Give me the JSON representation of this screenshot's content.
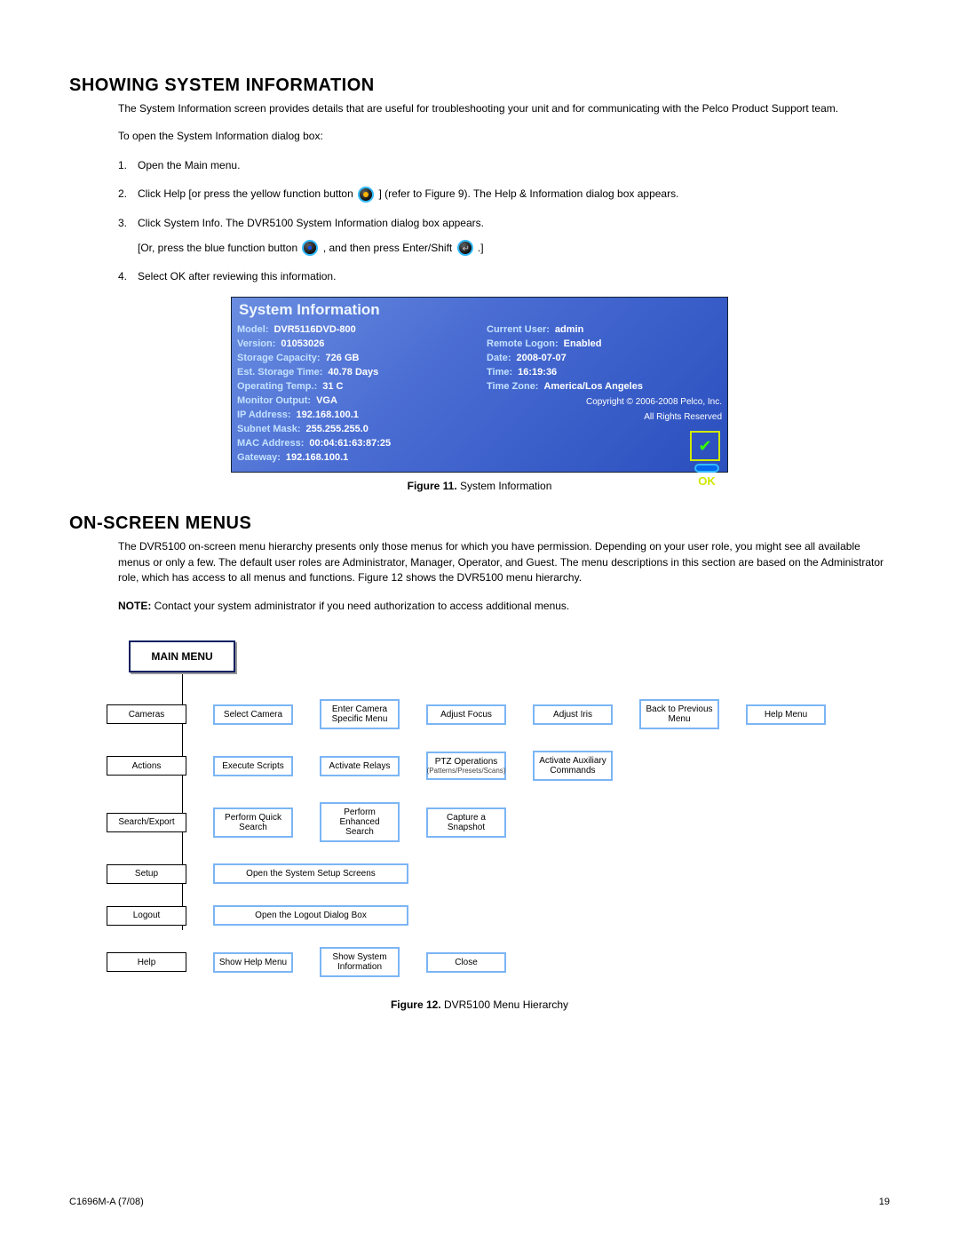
{
  "section1": {
    "heading": "SHOWING SYSTEM INFORMATION",
    "intro": "The System Information screen provides details that are useful for troubleshooting your unit and for communicating with the Pelco Product Support team.",
    "open_line": "To open the System Information dialog box:",
    "steps": {
      "s1": "Open the Main menu.",
      "s2a": "Click Help [or press the yellow function button",
      "s2b": "] (refer to Figure 9). The Help & Information dialog box appears.",
      "s3": "Click System Info. The DVR5100 System Information dialog box appears.",
      "s3sub_a": "[Or, press the blue function button",
      "s3sub_b": ", and then press Enter/Shift",
      "s3sub_c": ".]",
      "s4": "Select OK after reviewing this information."
    }
  },
  "sysinfo": {
    "title": "System Information",
    "left": {
      "model_l": "Model:",
      "model_v": "DVR5116DVD-800",
      "version_l": "Version:",
      "version_v": "01053026",
      "cap_l": "Storage Capacity:",
      "cap_v": "726  GB",
      "est_l": "Est. Storage Time:",
      "est_v": "40.78   Days",
      "temp_l": "Operating Temp.:",
      "temp_v": "31  C",
      "mon_l": "Monitor Output:",
      "mon_v": "VGA",
      "ip_l": "IP Address:",
      "ip_v": "192.168.100.1",
      "sub_l": "Subnet Mask:",
      "sub_v": "255.255.255.0",
      "mac_l": "MAC Address:",
      "mac_v": "00:04:61:63:87:25",
      "gw_l": "Gateway:",
      "gw_v": "192.168.100.1"
    },
    "right": {
      "cu_l": "Current User:",
      "cu_v": "admin",
      "rl_l": "Remote Logon:",
      "rl_v": "Enabled",
      "date_l": "Date:",
      "date_v": "2008-07-07",
      "time_l": "Time:",
      "time_v": "16:19:36",
      "tz_l": "Time Zone:",
      "tz_v": "America/Los Angeles",
      "copy1": "Copyright © 2006-2008 Pelco, Inc.",
      "copy2": "All Rights Reserved"
    },
    "ok": "OK"
  },
  "fig11": {
    "bold": "Figure 11.",
    "text": "  System Information"
  },
  "section2": {
    "heading": "ON-SCREEN MENUS",
    "para": "The DVR5100 on-screen menu hierarchy presents only those menus for which you have permission. Depending on your user role, you might see all available menus or only a few. The default user roles are Administrator, Manager, Operator, and Guest. The menu descriptions in this section are based on the Administrator role, which has access to all menus and functions. Figure 12 shows the DVR5100 menu hierarchy.",
    "note_bold": "NOTE:",
    "note_text": "  Contact your system administrator if you need authorization to access additional menus."
  },
  "diagram": {
    "main": "MAIN MENU",
    "r1": {
      "a": "Cameras",
      "b": "Select Camera",
      "c": "Enter Camera Specific Menu",
      "d": "Adjust Focus",
      "e": "Adjust Iris",
      "f": "Back to Previous Menu",
      "g": "Help Menu"
    },
    "r2": {
      "a": "Actions",
      "b": "Execute Scripts",
      "c": "Activate Relays",
      "d": "PTZ Operations",
      "dsub": "(Patterns/Presets/Scans)",
      "e": "Activate Auxiliary Commands"
    },
    "r3": {
      "a": "Search/Export",
      "b": "Perform Quick Search",
      "c": "Perform Enhanced Search",
      "d": "Capture a Snapshot"
    },
    "r4": {
      "a": "Setup",
      "b": "Open the System Setup Screens"
    },
    "r5": {
      "a": "Logout",
      "b": "Open the Logout Dialog Box"
    },
    "r6": {
      "a": "Help",
      "b": "Show Help Menu",
      "c": "Show System Information",
      "d": "Close"
    }
  },
  "fig12": {
    "bold": "Figure 12.",
    "text": "  DVR5100 Menu Hierarchy"
  },
  "footer": {
    "left": "C1696M-A (7/08)",
    "right": "19"
  }
}
